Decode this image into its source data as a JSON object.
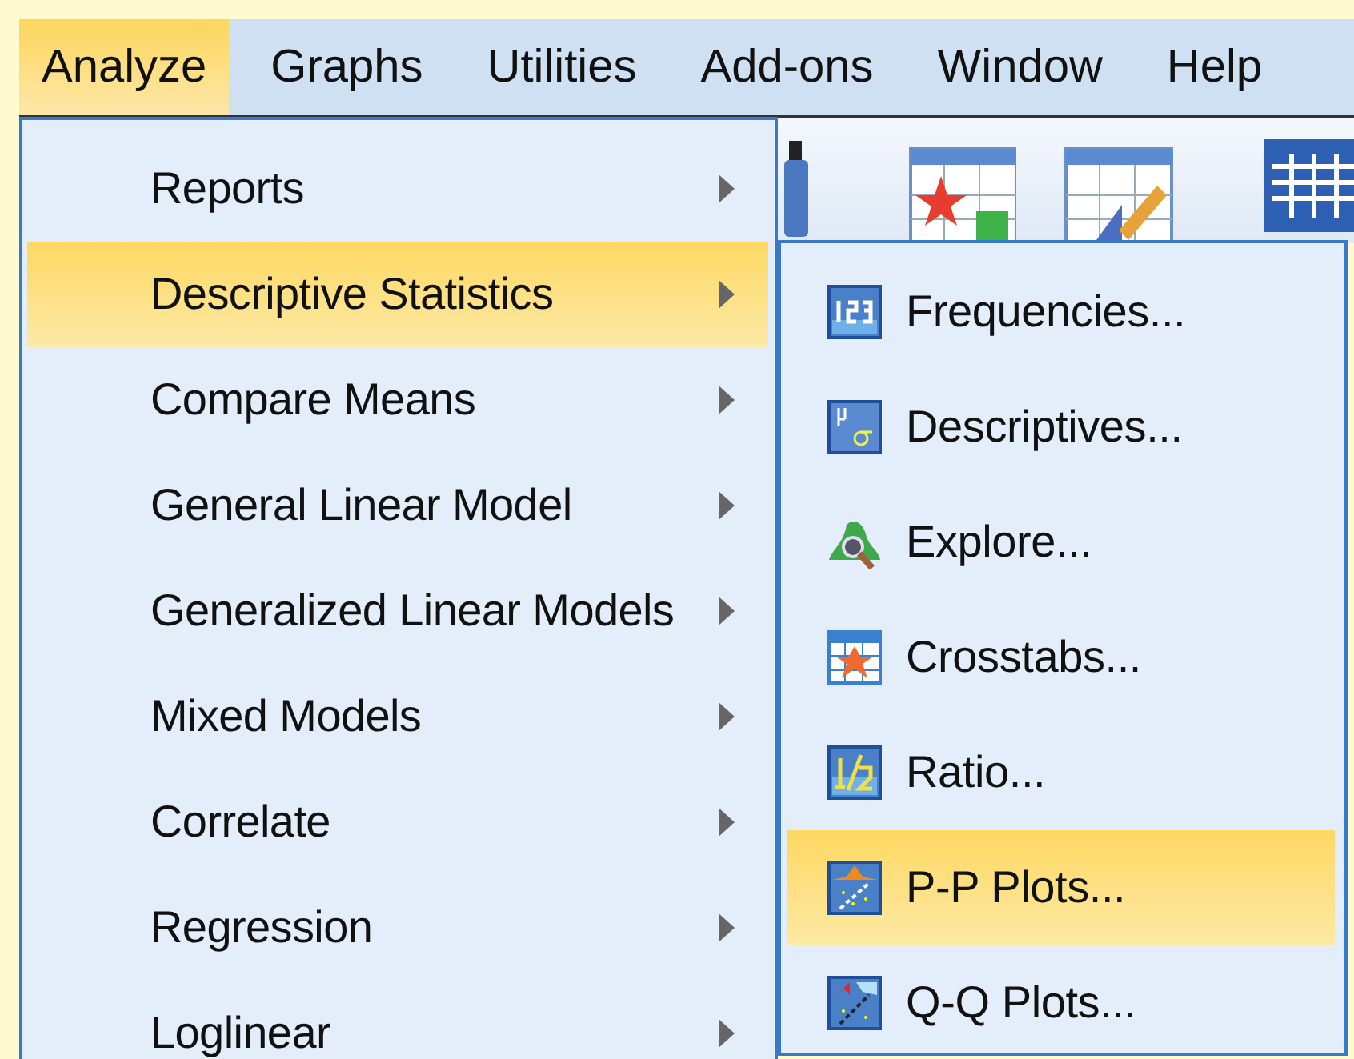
{
  "menubar": [
    {
      "label": "Analyze",
      "selected": true
    },
    {
      "label": "Graphs",
      "selected": false
    },
    {
      "label": "Utilities",
      "selected": false
    },
    {
      "label": "Add-ons",
      "selected": false
    },
    {
      "label": "Window",
      "selected": false
    },
    {
      "label": "Help",
      "selected": false
    }
  ],
  "menu": {
    "items": [
      {
        "label": "Reports",
        "selected": false,
        "has_submenu": true
      },
      {
        "label": "Descriptive Statistics",
        "selected": true,
        "has_submenu": true
      },
      {
        "label": "Compare Means",
        "selected": false,
        "has_submenu": true
      },
      {
        "label": "General Linear Model",
        "selected": false,
        "has_submenu": true
      },
      {
        "label": "Generalized Linear Models",
        "selected": false,
        "has_submenu": true
      },
      {
        "label": "Mixed Models",
        "selected": false,
        "has_submenu": true
      },
      {
        "label": "Correlate",
        "selected": false,
        "has_submenu": true
      },
      {
        "label": "Regression",
        "selected": false,
        "has_submenu": true
      },
      {
        "label": "Loglinear",
        "selected": false,
        "has_submenu": true
      }
    ]
  },
  "submenu": {
    "items": [
      {
        "label": "Frequencies...",
        "selected": false,
        "kind": "frequencies"
      },
      {
        "label": "Descriptives...",
        "selected": false,
        "kind": "descriptives"
      },
      {
        "label": "Explore...",
        "selected": false,
        "kind": "explore"
      },
      {
        "label": "Crosstabs...",
        "selected": false,
        "kind": "crosstabs"
      },
      {
        "label": "Ratio...",
        "selected": false,
        "kind": "ratio"
      },
      {
        "label": "P-P Plots...",
        "selected": true,
        "kind": "pp"
      },
      {
        "label": "Q-Q Plots...",
        "selected": false,
        "kind": "qq"
      }
    ]
  }
}
